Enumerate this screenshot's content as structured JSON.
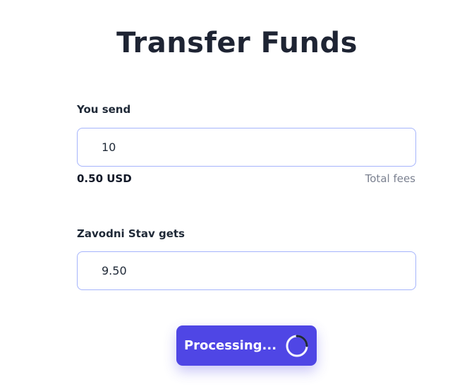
{
  "page": {
    "title": "Transfer Funds"
  },
  "send": {
    "label": "You send",
    "value": "10",
    "fee_amount": "0.50 USD",
    "fee_label": "Total fees"
  },
  "receive": {
    "label": "Zavodni Stav gets",
    "value": "9.50"
  },
  "submit": {
    "label": "Processing...",
    "icon": "spinner-icon",
    "color": "#4f46e5"
  }
}
